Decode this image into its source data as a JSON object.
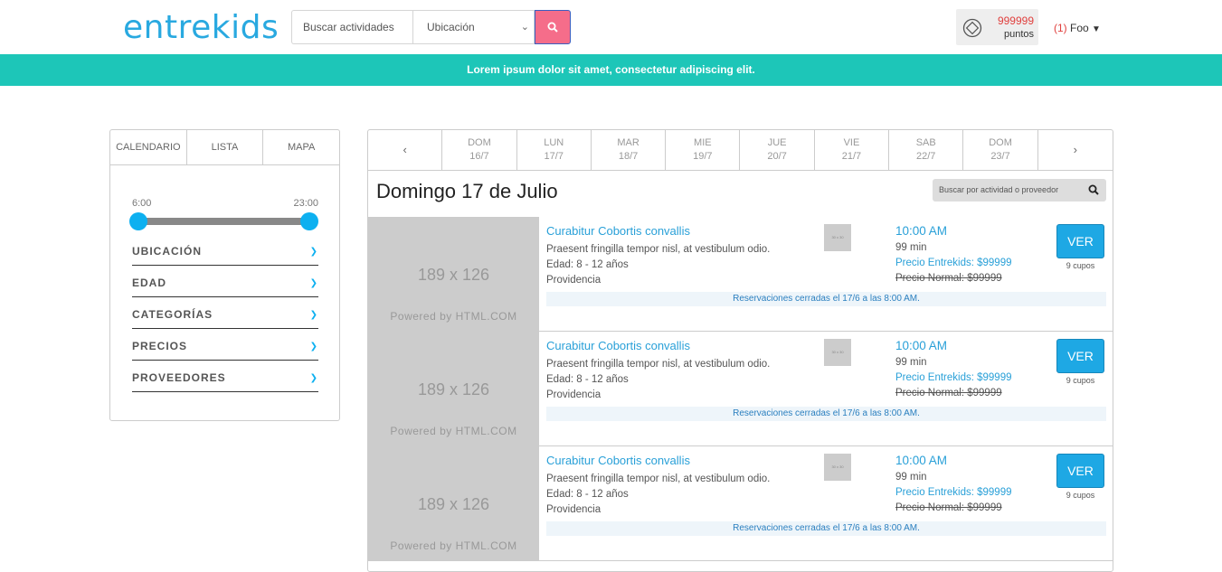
{
  "header": {
    "logo": "entrekids",
    "search_placeholder": "Buscar actividades",
    "location_label": "Ubicación",
    "points_value": "999999",
    "points_label": "puntos",
    "user_count": "(1)",
    "user_name": "Foo"
  },
  "banner": {
    "text": "Lorem ipsum dolor sit amet, consectetur adipiscing elit."
  },
  "sidebar": {
    "tabs": [
      "CALENDARIO",
      "LISTA",
      "MAPA"
    ],
    "time_start": "6:00",
    "time_end": "23:00",
    "filters": [
      "UBICACIÓN",
      "EDAD",
      "CATEGORÍAS",
      "PRECIOS",
      "PROVEEDORES"
    ]
  },
  "days": [
    {
      "name": "DOM",
      "date": "16/7"
    },
    {
      "name": "LUN",
      "date": "17/7"
    },
    {
      "name": "MAR",
      "date": "18/7"
    },
    {
      "name": "MIE",
      "date": "19/7"
    },
    {
      "name": "JUE",
      "date": "20/7"
    },
    {
      "name": "VIE",
      "date": "21/7"
    },
    {
      "name": "SAB",
      "date": "22/7"
    },
    {
      "name": "DOM",
      "date": "23/7"
    }
  ],
  "main": {
    "date_title": "Domingo 17 de Julio",
    "provider_search_placeholder": "Buscar por actividad o proveedor"
  },
  "activities": [
    {
      "thumb_dims": "189 x 126",
      "thumb_powered": "Powered by HTML.COM",
      "mini_thumb": "30 x 30",
      "title": "Curabitur Cobortis convallis",
      "desc": "Praesent fringilla tempor nisl, at vestibulum odio.",
      "age": "Edad: 8 - 12 años",
      "location": "Providencia",
      "time": "10:00 AM",
      "duration": "99 min",
      "price_entrekids": "Precio Entrekids: $99999",
      "price_normal": "Precio Normal: $99999",
      "button": "VER",
      "cupos": "9 cupos",
      "note": "Reservaciones cerradas el 17/6 a las 8:00 AM."
    },
    {
      "thumb_dims": "189 x 126",
      "thumb_powered": "Powered by HTML.COM",
      "mini_thumb": "30 x 30",
      "title": "Curabitur Cobortis convallis",
      "desc": "Praesent fringilla tempor nisl, at vestibulum odio.",
      "age": "Edad: 8 - 12 años",
      "location": "Providencia",
      "time": "10:00 AM",
      "duration": "99 min",
      "price_entrekids": "Precio Entrekids: $99999",
      "price_normal": "Precio Normal: $99999",
      "button": "VER",
      "cupos": "9 cupos",
      "note": "Reservaciones cerradas el 17/6 a las 8:00 AM."
    },
    {
      "thumb_dims": "189 x 126",
      "thumb_powered": "Powered by HTML.COM",
      "mini_thumb": "30 x 30",
      "title": "Curabitur Cobortis convallis",
      "desc": "Praesent fringilla tempor nisl, at vestibulum odio.",
      "age": "Edad: 8 - 12 años",
      "location": "Providencia",
      "time": "10:00 AM",
      "duration": "99 min",
      "price_entrekids": "Precio Entrekids: $99999",
      "price_normal": "Precio Normal: $99999",
      "button": "VER",
      "cupos": "9 cupos",
      "note": "Reservaciones cerradas el 17/6 a las 8:00 AM."
    }
  ]
}
